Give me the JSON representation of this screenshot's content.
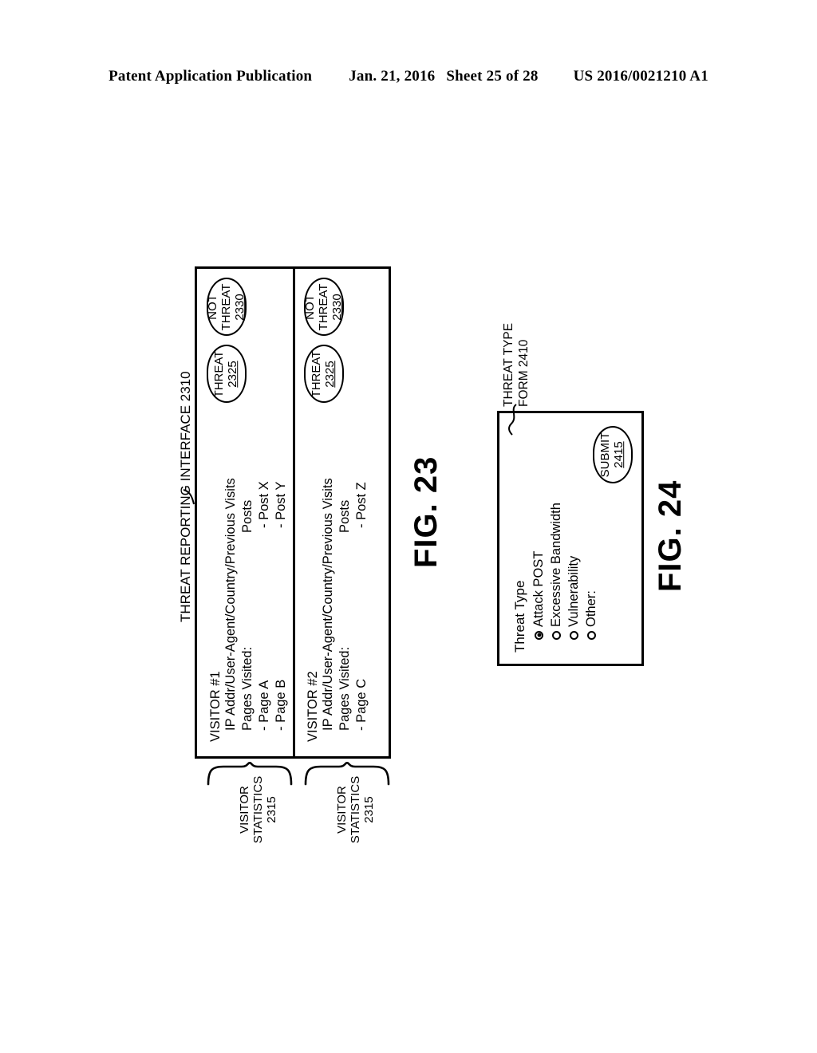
{
  "page_header": {
    "publication": "Patent Application Publication",
    "date": "Jan. 21, 2016",
    "sheet": "Sheet 25 of 28",
    "pub_number": "US 2016/0021210 A1"
  },
  "fig23": {
    "caption": "FIG. 23",
    "interface_label": "THREAT REPORTING INTERFACE 2310",
    "visitors": [
      {
        "title": "VISITOR #1",
        "ip_line": "IP Addr/User-Agent/Country/Previous Visits",
        "pages_heading": "Pages Visited:",
        "pages": [
          "- Page A",
          "- Page B"
        ],
        "posts_heading": "Posts",
        "posts": [
          "- Post X",
          "- Post Y"
        ],
        "threat_button": {
          "label": "THREAT",
          "ref": "2325"
        },
        "not_threat_button": {
          "label_line1": "NOT",
          "label_line2": "THREAT",
          "ref": "2330"
        },
        "brace_label_line1": "VISITOR",
        "brace_label_line2": "STATISTICS",
        "brace_ref": "2315"
      },
      {
        "title": "VISITOR #2",
        "ip_line": "IP Addr/User-Agent/Country/Previous Visits",
        "pages_heading": "Pages Visited:",
        "pages": [
          "- Page C"
        ],
        "posts_heading": "Posts",
        "posts": [
          "- Post Z"
        ],
        "threat_button": {
          "label": "THREAT",
          "ref": "2325"
        },
        "not_threat_button": {
          "label_line1": "NOT",
          "label_line2": "THREAT",
          "ref": "2330"
        },
        "brace_label_line1": "VISITOR",
        "brace_label_line2": "STATISTICS",
        "brace_ref": "2315"
      }
    ]
  },
  "fig24": {
    "caption": "FIG. 24",
    "form_label_line1": "THREAT TYPE",
    "form_label_line2": "FORM 2410",
    "heading": "Threat Type",
    "options": [
      {
        "label": "Attack POST",
        "selected": true
      },
      {
        "label": "Excessive Bandwidth",
        "selected": false
      },
      {
        "label": "Vulnerability",
        "selected": false
      },
      {
        "label": "Other:",
        "selected": false
      }
    ],
    "submit_button": {
      "label": "SUBMIT",
      "ref": "2415"
    }
  }
}
